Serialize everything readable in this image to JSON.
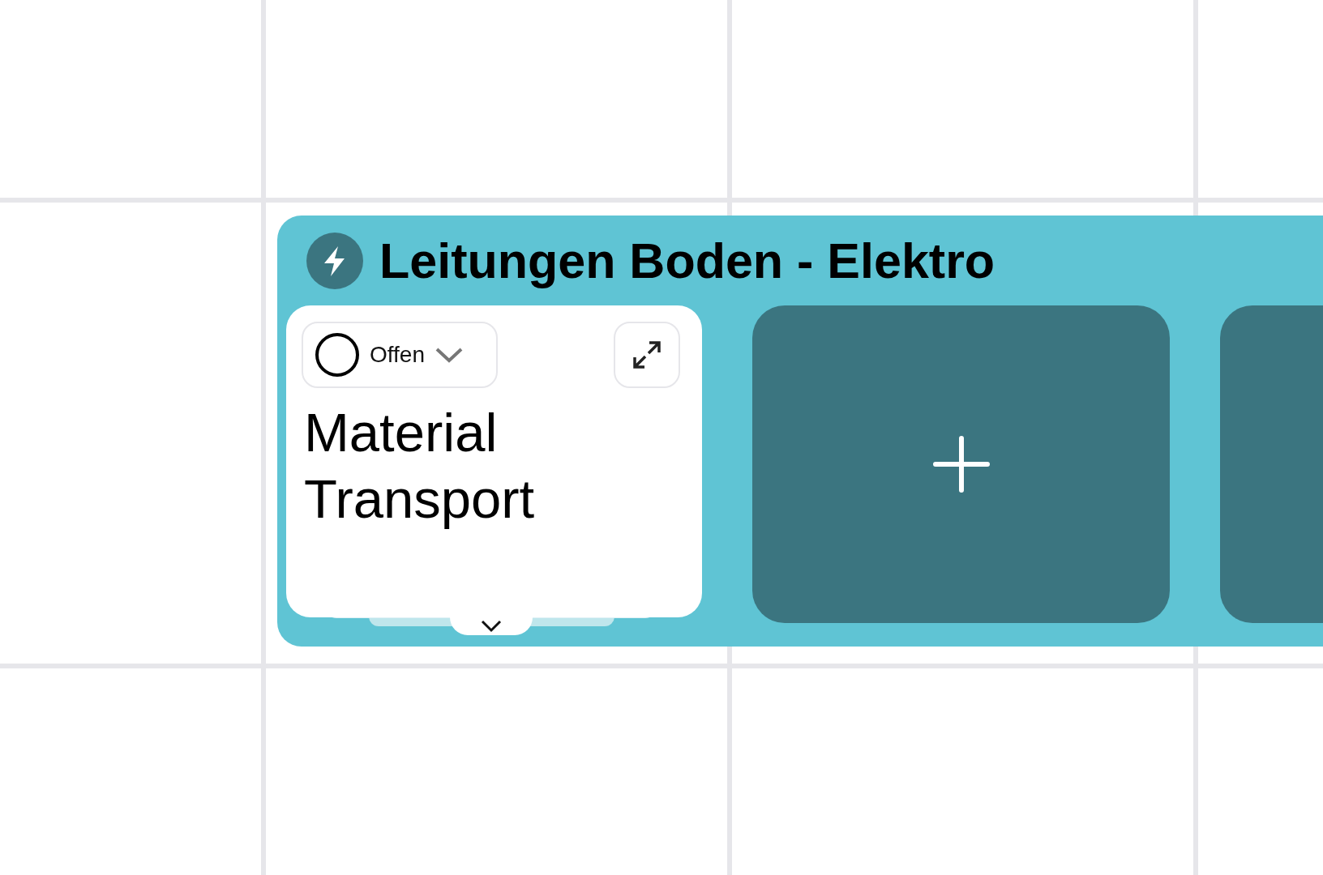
{
  "group": {
    "title": "Leitungen Boden - Elektro",
    "tiles": [
      {
        "kind": "task",
        "status": {
          "label": "Offen",
          "done": false
        },
        "title": "Material Transport",
        "stacked": true
      },
      {
        "kind": "add"
      },
      {
        "kind": "empty"
      }
    ]
  }
}
